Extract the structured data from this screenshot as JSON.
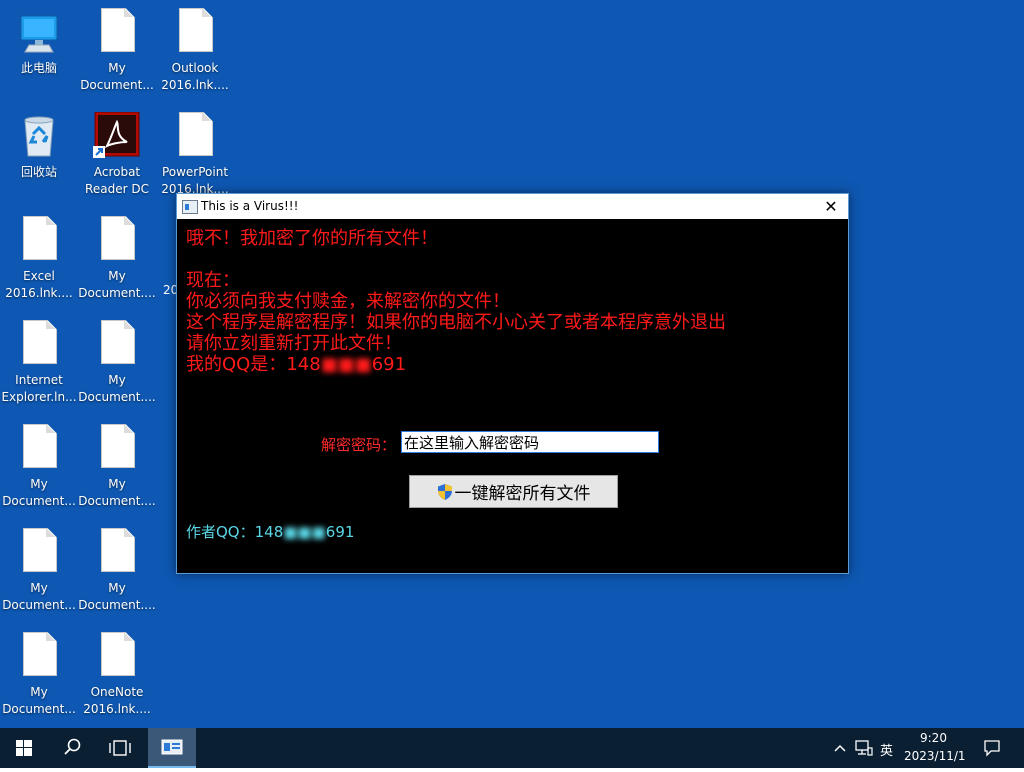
{
  "desktop": {
    "background": "#0e58b3",
    "icons": [
      {
        "label": "此电脑",
        "icon": "computer-icon"
      },
      {
        "label": "My\nDocument...",
        "icon": "file-icon"
      },
      {
        "label": "Outlook\n2016.lnk....",
        "icon": "file-icon"
      },
      {
        "label": "回收站",
        "icon": "recycle-bin-icon"
      },
      {
        "label": "Acrobat\nReader DC",
        "icon": "acrobat-icon"
      },
      {
        "label": "PowerPoint\n2016.lnk....",
        "icon": "file-icon"
      },
      {
        "label": "Excel\n2016.lnk....",
        "icon": "file-icon"
      },
      {
        "label": "My\nDocument....",
        "icon": "file-icon"
      },
      {
        "label": "Internet\nExplorer.ln...",
        "icon": "file-icon"
      },
      {
        "label": "My\nDocument....",
        "icon": "file-icon"
      },
      {
        "label": "My\nDocument...",
        "icon": "file-icon"
      },
      {
        "label": "My\nDocument....",
        "icon": "file-icon"
      },
      {
        "label": "My\nDocument...",
        "icon": "file-icon"
      },
      {
        "label": "My\nDocument....",
        "icon": "file-icon"
      },
      {
        "label": "My\nDocument...",
        "icon": "file-icon"
      },
      {
        "label": "OneNote\n2016.lnk....",
        "icon": "file-icon"
      }
    ],
    "partial_label": "20"
  },
  "window": {
    "title": "This is a Virus!!!",
    "close_glyph": "✕",
    "lines": [
      "哦不！我加密了你的所有文件！",
      "",
      "现在：",
      "你必须向我支付赎金，来解密你的文件！",
      "这个程序是解密程序！如果你的电脑不小心关了或者本程序意外退出",
      "请你立刻重新打开此文件！"
    ],
    "qq_line_prefix": "我的QQ是：148",
    "qq_line_suffix": "691",
    "password_label": "解密密码：",
    "password_value": "在这里输入解密密码",
    "decrypt_button": "一键解密所有文件",
    "author_prefix": "作者QQ：148",
    "author_suffix": "691",
    "colors": {
      "message": "#ff1a1a",
      "author": "#5ad7e6",
      "background": "#000000"
    }
  },
  "taskbar": {
    "ime": "英",
    "time": "9:20",
    "date": "2023/11/1"
  }
}
